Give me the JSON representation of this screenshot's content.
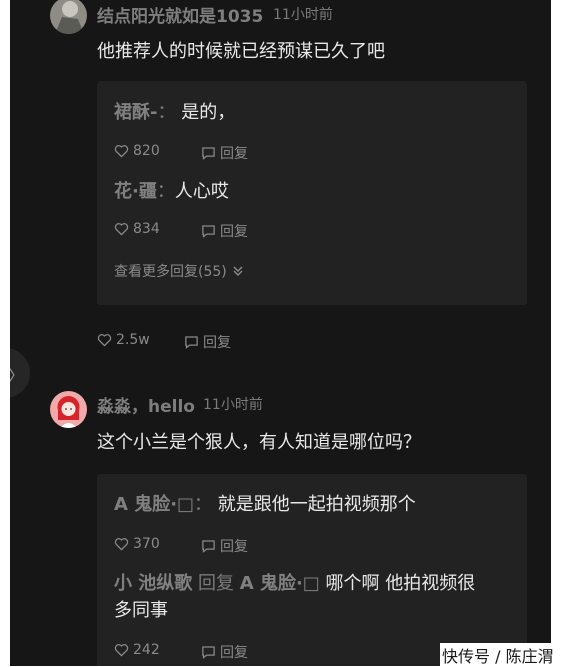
{
  "comment1": {
    "username": "结点阳光就如是1035",
    "time": "11小时前",
    "text": "他推荐人的时候就已经预谋已久了吧",
    "replies": [
      {
        "name": "裙酥-",
        "sep": "：",
        "text": "是的，",
        "likes": "820",
        "reply_label": "回复"
      },
      {
        "name": "花·疆",
        "sep": "：",
        "text": "人心哎",
        "likes": "834",
        "reply_label": "回复"
      }
    ],
    "more_replies": "查看更多回复(55)",
    "likes": "2.5w",
    "reply_label": "回复"
  },
  "comment2": {
    "username": "淼淼，hello",
    "time": "11小时前",
    "text": "这个小兰是个狠人，有人知道是哪位吗？",
    "replies": [
      {
        "name": "A 鬼脸·□",
        "sep": "：",
        "text": "就是跟他一起拍视频那个",
        "likes": "370",
        "reply_label": "回复"
      },
      {
        "name": "小 池纵歌",
        "mid": "回复",
        "target": "A 鬼脸·□",
        "text_line1": "哪个啊 他拍视频很",
        "text_line2": "多同事",
        "likes": "242",
        "reply_label": "回复"
      }
    ]
  },
  "side_tab_glyph": "〉",
  "watermark": "快传号 / 陈庄渭",
  "colors": {
    "background": "#161616",
    "reply_box": "#222222",
    "text": "#e9e9e9",
    "muted": "#7e7e7e"
  },
  "icons": {
    "like": "heart-icon",
    "reply": "comment-icon",
    "more": "double-chevron-down-icon"
  }
}
